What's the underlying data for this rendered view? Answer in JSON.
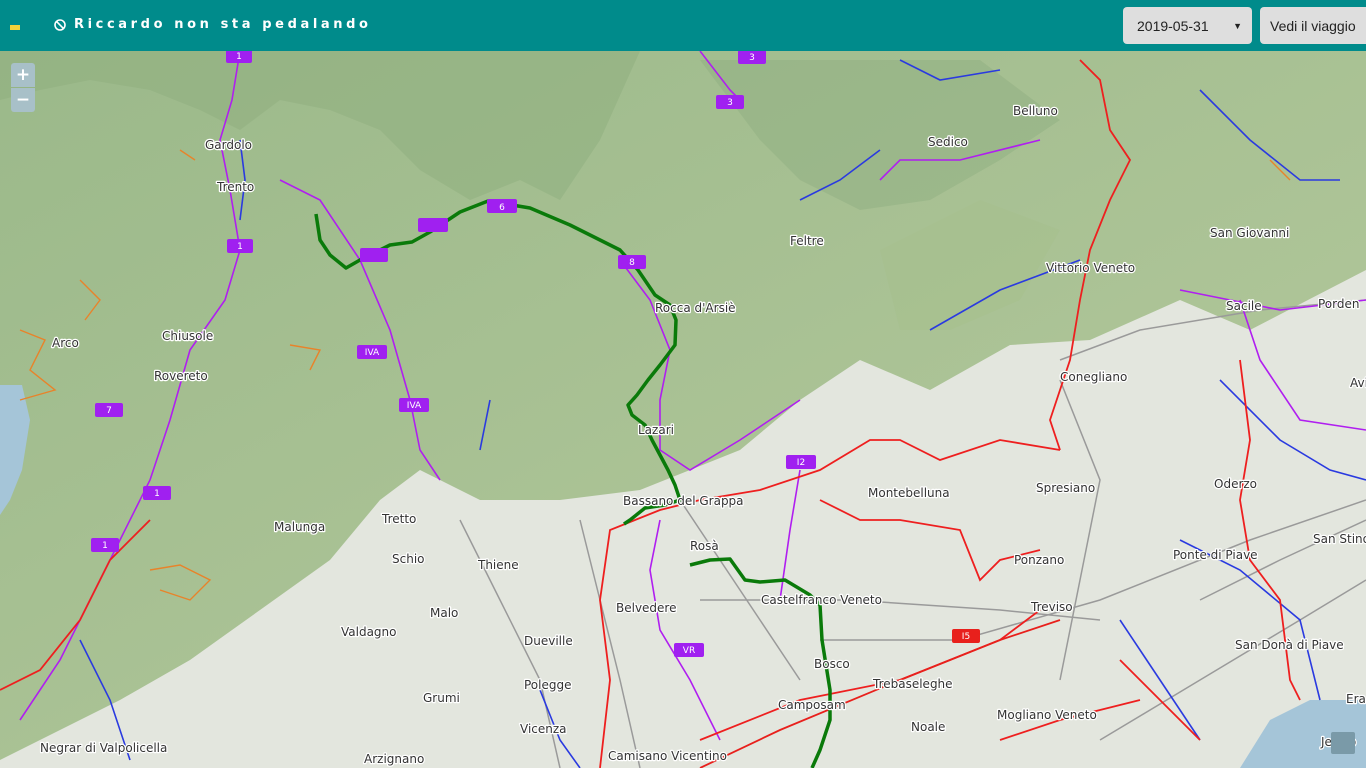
{
  "header": {
    "status_text": "Riccardo non sta pedalando",
    "status_icon": "ban-icon",
    "date_value": "2019-05-31",
    "view_button_label": "Vedi il viaggio"
  },
  "map_controls": {
    "zoom_in_label": "+",
    "zoom_out_label": "−"
  },
  "colors": {
    "header_bg": "#008b8b",
    "route": "#0a7a0a",
    "shield": "#a020f0",
    "motorway_shield": "#e8201c"
  },
  "cities": {
    "gardolo": "Gardolo",
    "trento": "Trento",
    "arco": "Arco",
    "chiusole": "Chiusole",
    "rovereto": "Rovereto",
    "malunga": "Malunga",
    "tretto": "Tretto",
    "schio": "Schio",
    "thiene": "Thiene",
    "malo": "Malo",
    "valdagno": "Valdagno",
    "dueville": "Dueville",
    "polegge": "Polegge",
    "grumi": "Grumi",
    "vicenza": "Vicenza",
    "arzignano": "Arzignano",
    "negrar": "Negrar di Valpolicella",
    "camisano": "Camisano Vicentino",
    "belvedere": "Belvedere",
    "rosa": "Rosà",
    "bassano": "Bassano del Grappa",
    "lazari": "Lazari",
    "rocca": "Rocca d'Arsiè",
    "castelfranco": "Castelfranco Veneto",
    "bosco": "Bosco",
    "camposampiero": "Camposam",
    "trebaseleghe": "Trebaseleghe",
    "noale": "Noale",
    "mogliano": "Mogliano Veneto",
    "treviso": "Treviso",
    "ponzano": "Ponzano",
    "montebelluna": "Montebelluna",
    "spresiano": "Spresiano",
    "conegliano": "Conegliano",
    "oderzo": "Oderzo",
    "ponte_piave": "Ponte di Piave",
    "san_dona": "San Donà di Piave",
    "san_stino": "San Stino",
    "jesolo": "Jesolo",
    "era": "Era",
    "vittorio": "Vittorio Veneto",
    "sacile": "Sacile",
    "pordenone": "Porden",
    "san_giovanni": "San Giovanni",
    "feltre": "Feltre",
    "sedico": "Sedico",
    "belluno": "Belluno",
    "avi": "Avi"
  },
  "shields": {
    "s1": "1",
    "s3": "3",
    "s7": "7",
    "s6": "6",
    "s8": "8",
    "iva": "IVA",
    "i2": "I2",
    "i5": "I5",
    "vr": "VR"
  }
}
